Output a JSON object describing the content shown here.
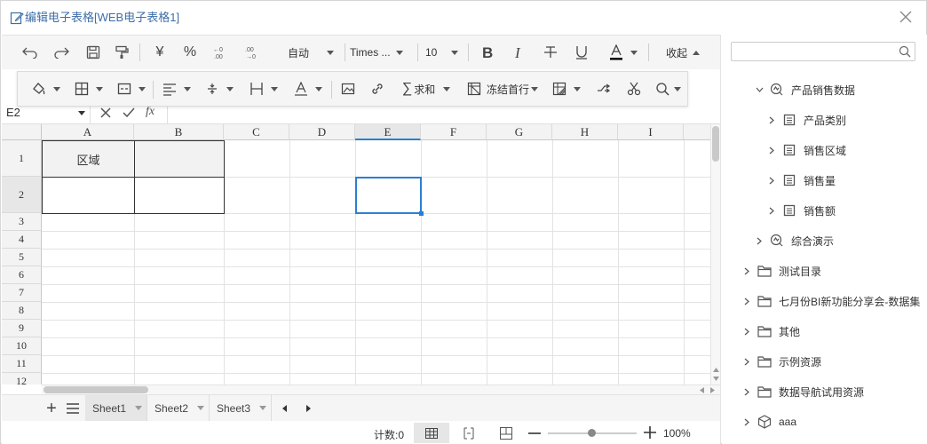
{
  "window": {
    "title": "编辑电子表格[WEB电子表格1]"
  },
  "toolbar1": {
    "currency": "¥",
    "percent": "%",
    "wrap_mode": "自动",
    "font_family": "Times ...",
    "font_size": "10",
    "collapse_label": "收起"
  },
  "toolbar2": {
    "sum_label": "求和",
    "freeze_label": "冻结首行"
  },
  "formula_bar": {
    "cell_ref": "E2",
    "fx": "fx"
  },
  "grid": {
    "columns": [
      "A",
      "B",
      "C",
      "D",
      "E",
      "F",
      "G",
      "H",
      "I"
    ],
    "selected_column": "E",
    "rows": [
      "1",
      "2",
      "3",
      "4",
      "5",
      "6",
      "7",
      "8",
      "9",
      "10",
      "11",
      "12"
    ],
    "selected_row": "2",
    "cells": {
      "A1": "区域"
    }
  },
  "sheets": {
    "tabs": [
      "Sheet1",
      "Sheet2",
      "Sheet3"
    ],
    "active": "Sheet1"
  },
  "status": {
    "count_label": "计数:0",
    "zoom": "100%"
  },
  "panel": {
    "search_placeholder": "",
    "tree": [
      {
        "label": "产品销售数据",
        "icon": "dataset-icon",
        "expanded": true
      },
      {
        "label": "产品类别",
        "icon": "field-icon"
      },
      {
        "label": "销售区域",
        "icon": "field-icon"
      },
      {
        "label": "销售量",
        "icon": "field-icon"
      },
      {
        "label": "销售额",
        "icon": "field-icon"
      },
      {
        "label": "综合演示",
        "icon": "dataset-icon"
      },
      {
        "label": "测试目录",
        "icon": "folder-icon"
      },
      {
        "label": "七月份BI新功能分享会-数据集",
        "icon": "folder-icon"
      },
      {
        "label": "其他",
        "icon": "folder-icon"
      },
      {
        "label": "示例资源",
        "icon": "folder-icon"
      },
      {
        "label": "数据导航试用资源",
        "icon": "folder-icon"
      },
      {
        "label": "aaa",
        "icon": "cube-icon"
      }
    ]
  },
  "colors": {
    "accent": "#2a7fd4",
    "title": "#3d6ea8"
  }
}
